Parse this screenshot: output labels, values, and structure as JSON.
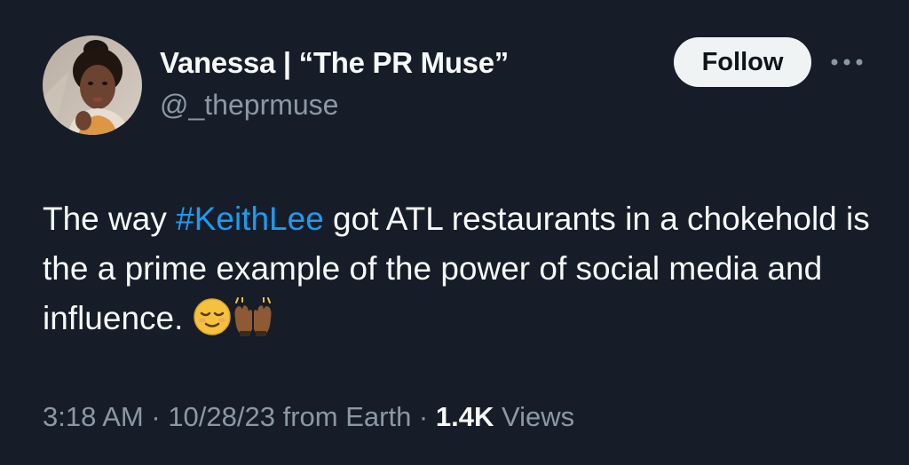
{
  "author": {
    "display_name": "Vanessa | “The PR Muse”",
    "handle": "@_theprmuse",
    "avatar_icon": "profile-photo"
  },
  "actions": {
    "follow_label": "Follow",
    "more_icon": "more-dots-icon"
  },
  "tweet": {
    "text_before": "The way ",
    "hashtag": "#KeithLee",
    "text_after": " got ATL restaurants in a chokehold is the a prime example of the power of social media and influence. ",
    "emojis": [
      "relieved-face-emoji",
      "raising-hands-emoji"
    ]
  },
  "meta": {
    "time": "3:18 AM",
    "sep1": " · ",
    "date": "10/28/23",
    "source": " from Earth",
    "sep2": " · ",
    "views_count": "1.4K",
    "views_label": " Views"
  },
  "colors": {
    "background": "#161d28",
    "text": "#f7f9f9",
    "secondary": "#8b98a5",
    "link": "#1d9bf0",
    "follow_bg": "#eff3f4"
  }
}
